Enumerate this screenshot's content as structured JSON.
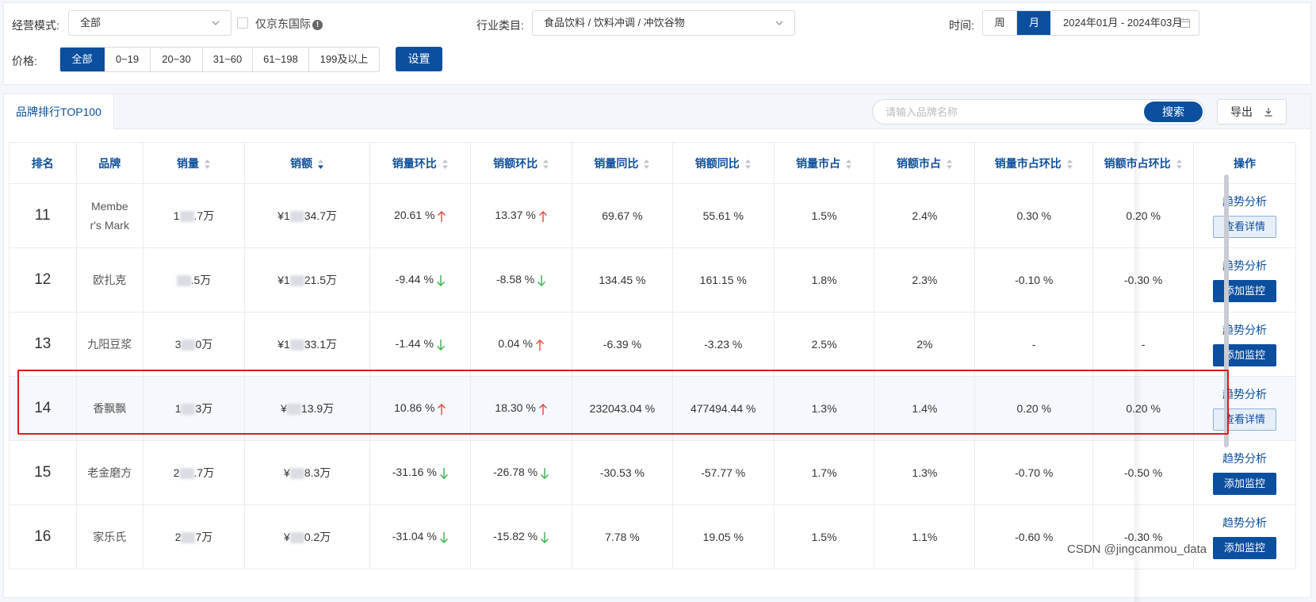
{
  "filters": {
    "mode_label": "经营模式:",
    "mode_value": "全部",
    "jd_intl_label": "仅京东国际",
    "industry_label": "行业类目:",
    "industry_value": "食品饮料 / 饮料冲调 / 冲饮谷物",
    "time_label": "时间:",
    "time_tabs": [
      "周",
      "月"
    ],
    "time_active": "月",
    "date_range": "2024年01月 - 2024年03月",
    "price_label": "价格:",
    "price_options": [
      "全部",
      "0~19",
      "20~30",
      "31~60",
      "61~198",
      "199及以上"
    ],
    "price_active": "全部",
    "settings_label": "设置"
  },
  "panel": {
    "tab_label": "品牌排行TOP100",
    "search_placeholder": "请输入品牌名称",
    "search_button": "搜索",
    "export_button": "导出"
  },
  "table": {
    "headers": [
      "排名",
      "品牌",
      "销量",
      "销额",
      "销量环比",
      "销额环比",
      "销量同比",
      "销额同比",
      "销量市占",
      "销额市占",
      "销量市占环比",
      "销额市占环比",
      "操作"
    ],
    "action_link": "趋势分析",
    "rows": [
      {
        "rank": "11",
        "brand1": "Membe",
        "brand2": "r's Mark",
        "sales_a": "1",
        "sales_b": ".7万",
        "amount_a": "¥1",
        "amount_b": "34.7万",
        "qty_mom": "20.61 %",
        "qty_mom_dir": "up",
        "amt_mom": "13.37 %",
        "amt_mom_dir": "up",
        "qty_yoy": "69.67 %",
        "amt_yoy": "55.61 %",
        "qty_share": "1.5%",
        "amt_share": "2.4%",
        "qty_share_mom": "0.30 %",
        "amt_share_mom": "0.20 %",
        "button": "查看详情",
        "button_type": "detail"
      },
      {
        "rank": "12",
        "brand1": "欧扎克",
        "brand2": "",
        "sales_a": "",
        "sales_b": ".5万",
        "amount_a": "¥1",
        "amount_b": "21.5万",
        "qty_mom": "-9.44 %",
        "qty_mom_dir": "down",
        "amt_mom": "-8.58 %",
        "amt_mom_dir": "down",
        "qty_yoy": "134.45 %",
        "amt_yoy": "161.15 %",
        "qty_share": "1.8%",
        "amt_share": "2.3%",
        "qty_share_mom": "-0.10 %",
        "amt_share_mom": "-0.30 %",
        "button": "添加监控",
        "button_type": "monitor"
      },
      {
        "rank": "13",
        "brand1": "九阳豆浆",
        "brand2": "",
        "sales_a": "3",
        "sales_b": "0万",
        "amount_a": "¥1",
        "amount_b": "33.1万",
        "qty_mom": "-1.44 %",
        "qty_mom_dir": "down",
        "amt_mom": "0.04 %",
        "amt_mom_dir": "up",
        "qty_yoy": "-6.39 %",
        "amt_yoy": "-3.23 %",
        "qty_share": "2.5%",
        "amt_share": "2%",
        "qty_share_mom": "-",
        "amt_share_mom": "-",
        "button": "添加监控",
        "button_type": "monitor"
      },
      {
        "rank": "14",
        "brand1": "香飘飘",
        "brand2": "",
        "sales_a": "1",
        "sales_b": "3万",
        "amount_a": "¥",
        "amount_b": "13.9万",
        "qty_mom": "10.86 %",
        "qty_mom_dir": "up",
        "amt_mom": "18.30 %",
        "amt_mom_dir": "up",
        "qty_yoy": "232043.04 %",
        "amt_yoy": "477494.44 %",
        "qty_share": "1.3%",
        "amt_share": "1.4%",
        "qty_share_mom": "0.20 %",
        "amt_share_mom": "0.20 %",
        "button": "查看详情",
        "button_type": "detail"
      },
      {
        "rank": "15",
        "brand1": "老金磨方",
        "brand2": "",
        "sales_a": "2",
        "sales_b": ".7万",
        "amount_a": "¥",
        "amount_b": "8.3万",
        "qty_mom": "-31.16 %",
        "qty_mom_dir": "down",
        "amt_mom": "-26.78 %",
        "amt_mom_dir": "down",
        "qty_yoy": "-30.53 %",
        "amt_yoy": "-57.77 %",
        "qty_share": "1.7%",
        "amt_share": "1.3%",
        "qty_share_mom": "-0.70 %",
        "amt_share_mom": "-0.50 %",
        "button": "添加监控",
        "button_type": "monitor"
      },
      {
        "rank": "16",
        "brand1": "家乐氏",
        "brand2": "",
        "sales_a": "2",
        "sales_b": "7万",
        "amount_a": "¥",
        "amount_b": "0.2万",
        "qty_mom": "-31.04 %",
        "qty_mom_dir": "down",
        "amt_mom": "-15.82 %",
        "amt_mom_dir": "down",
        "qty_yoy": "7.78 %",
        "amt_yoy": "19.05 %",
        "qty_share": "1.5%",
        "amt_share": "1.1%",
        "qty_share_mom": "-0.60 %",
        "amt_share_mom": "-0.30 %",
        "button": "添加监控",
        "button_type": "monitor"
      }
    ]
  },
  "colors": {
    "primary": "#0c4f9e",
    "up": "#e8453c",
    "down": "#36b24a",
    "highlight": "#e0191a"
  },
  "watermark": "CSDN @jingcanmou_data"
}
